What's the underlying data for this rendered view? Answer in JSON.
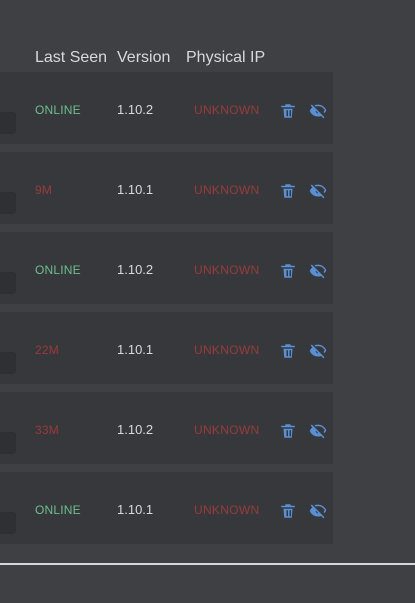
{
  "theme": {
    "online_color": "#6bbf8f",
    "offline_color": "#9b3a3a",
    "unknown_ip_color": "#9b3a3a",
    "icon_color": "#5a8fd6"
  },
  "table": {
    "headers": {
      "last_seen": "Last Seen",
      "version": "Version",
      "physical_ip": "Physical IP"
    },
    "rows": [
      {
        "last_seen": "ONLINE",
        "status": "online",
        "version": "1.10.2",
        "physical_ip": "UNKNOWN"
      },
      {
        "last_seen": "9M",
        "status": "offline",
        "version": "1.10.1",
        "physical_ip": "UNKNOWN"
      },
      {
        "last_seen": "ONLINE",
        "status": "online",
        "version": "1.10.2",
        "physical_ip": "UNKNOWN"
      },
      {
        "last_seen": "22M",
        "status": "offline",
        "version": "1.10.1",
        "physical_ip": "UNKNOWN"
      },
      {
        "last_seen": "33M",
        "status": "offline",
        "version": "1.10.2",
        "physical_ip": "UNKNOWN"
      },
      {
        "last_seen": "ONLINE",
        "status": "online",
        "version": "1.10.1",
        "physical_ip": "UNKNOWN"
      }
    ],
    "row_actions": {
      "delete_icon": "trash-icon",
      "hide_icon": "eye-off-icon"
    }
  }
}
